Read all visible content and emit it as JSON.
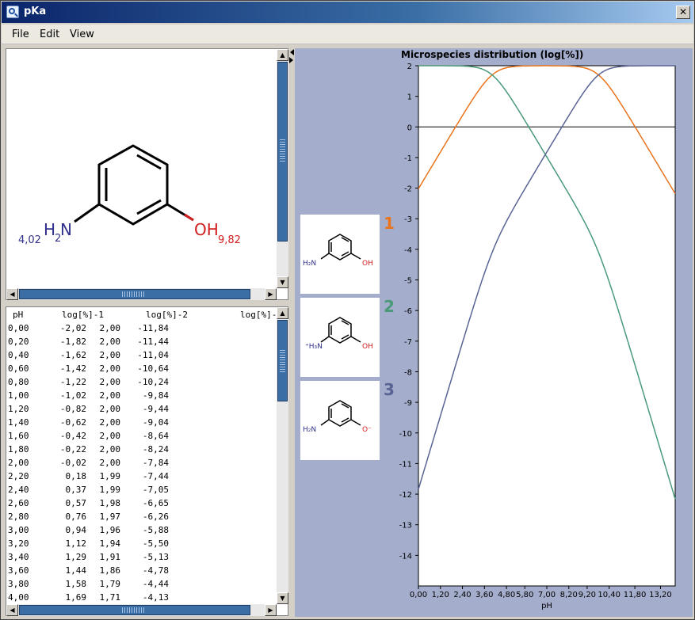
{
  "window": {
    "title": "pKa",
    "close_glyph": "✕"
  },
  "menu": {
    "items": [
      "File",
      "Edit",
      "View"
    ]
  },
  "structure": {
    "nh2_label": "H",
    "nh2_sub": "2",
    "nh2_n": "N",
    "oh_label": "OH",
    "pka_amine": "4,02",
    "pka_hydroxyl": "9,82",
    "colors": {
      "amine": "#30308c",
      "hydroxyl": "#d21e1e",
      "bond": "#000000"
    }
  },
  "table": {
    "headers": [
      "pH",
      "log[%]-1",
      "log[%]-2",
      "log[%]-"
    ],
    "rows": [
      [
        "0,00",
        "-2,02",
        "2,00",
        "-11,84"
      ],
      [
        "0,20",
        "-1,82",
        "2,00",
        "-11,44"
      ],
      [
        "0,40",
        "-1,62",
        "2,00",
        "-11,04"
      ],
      [
        "0,60",
        "-1,42",
        "2,00",
        "-10,64"
      ],
      [
        "0,80",
        "-1,22",
        "2,00",
        "-10,24"
      ],
      [
        "1,00",
        "-1,02",
        "2,00",
        "-9,84"
      ],
      [
        "1,20",
        "-0,82",
        "2,00",
        "-9,44"
      ],
      [
        "1,40",
        "-0,62",
        "2,00",
        "-9,04"
      ],
      [
        "1,60",
        "-0,42",
        "2,00",
        "-8,64"
      ],
      [
        "1,80",
        "-0,22",
        "2,00",
        "-8,24"
      ],
      [
        "2,00",
        "-0,02",
        "2,00",
        "-7,84"
      ],
      [
        "2,20",
        "0,18",
        "1,99",
        "-7,44"
      ],
      [
        "2,40",
        "0,37",
        "1,99",
        "-7,05"
      ],
      [
        "2,60",
        "0,57",
        "1,98",
        "-6,65"
      ],
      [
        "2,80",
        "0,76",
        "1,97",
        "-6,26"
      ],
      [
        "3,00",
        "0,94",
        "1,96",
        "-5,88"
      ],
      [
        "3,20",
        "1,12",
        "1,94",
        "-5,50"
      ],
      [
        "3,40",
        "1,29",
        "1,91",
        "-5,13"
      ],
      [
        "3,60",
        "1,44",
        "1,86",
        "-4,78"
      ],
      [
        "3,80",
        "1,58",
        "1,79",
        "-4,44"
      ],
      [
        "4,00",
        "1,69",
        "1,71",
        "-4,13"
      ]
    ]
  },
  "species": [
    {
      "num": "1",
      "color": "#e8741e",
      "n_label": "H₂N",
      "o_label": "OH"
    },
    {
      "num": "2",
      "color": "#4a9a7a",
      "n_label": "⁺H₃N",
      "o_label": "OH"
    },
    {
      "num": "3",
      "color": "#5a6494",
      "n_label": "H₂N",
      "o_label": "O⁻"
    }
  ],
  "chart_data": {
    "type": "line",
    "title": "Microspecies distribution (log[%])",
    "xlabel": "pH",
    "ylabel": "",
    "xlim": [
      0,
      14
    ],
    "ylim": [
      -15,
      2
    ],
    "x_ticks": [
      "0,00",
      "1,20",
      "2,40",
      "3,60",
      "4,80",
      "5,80",
      "7,00",
      "8,20",
      "9,20",
      "10,40",
      "11,80",
      "13,20"
    ],
    "x_tick_values": [
      0.0,
      1.2,
      2.4,
      3.6,
      4.8,
      5.8,
      7.0,
      8.2,
      9.2,
      10.4,
      11.8,
      13.2
    ],
    "y_ticks": [
      2,
      1,
      0,
      -1,
      -2,
      -3,
      -4,
      -5,
      -6,
      -7,
      -8,
      -9,
      -10,
      -11,
      -12,
      -13,
      -14
    ],
    "y_tick_labels": [
      "2",
      "1",
      "0",
      "-1",
      "-2",
      "-3",
      "-4",
      "-5",
      "-6",
      "-7",
      "-8",
      "-9",
      "-10",
      "-11",
      "-12",
      "-13",
      "-14"
    ],
    "pKa": [
      4.02,
      9.82
    ],
    "zero_line": 0,
    "series": [
      {
        "species": "1",
        "color": "#e8741e"
      },
      {
        "species": "2",
        "color": "#4a9a7a"
      },
      {
        "species": "3",
        "color": "#5a6494"
      }
    ]
  }
}
